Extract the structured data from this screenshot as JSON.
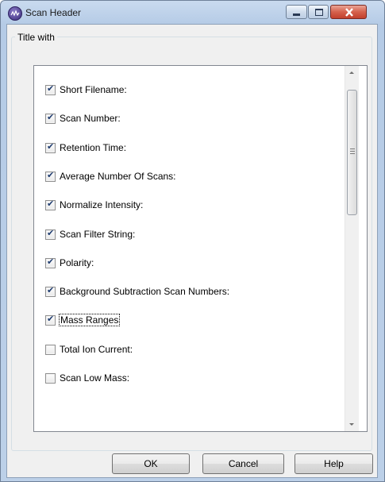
{
  "window": {
    "title": "Scan Header"
  },
  "group": {
    "legend": "Title with"
  },
  "items": [
    {
      "label": "Short Filename:",
      "checked": true
    },
    {
      "label": "Scan Number:",
      "checked": true
    },
    {
      "label": "Retention Time:",
      "checked": true
    },
    {
      "label": "Average Number Of Scans:",
      "checked": true
    },
    {
      "label": "Normalize Intensity:",
      "checked": true
    },
    {
      "label": "Scan Filter String:",
      "checked": true
    },
    {
      "label": "Polarity:",
      "checked": true
    },
    {
      "label": "Background Subtraction Scan Numbers:",
      "checked": true
    },
    {
      "label": "Mass Ranges",
      "checked": true,
      "focused": true
    },
    {
      "label": "Total Ion Current:",
      "checked": false
    },
    {
      "label": "Scan Low Mass:",
      "checked": false
    }
  ],
  "buttons": {
    "ok": "OK",
    "cancel": "Cancel",
    "help": "Help"
  },
  "icons": {
    "app": "app-logo-icon",
    "minimize": "minimize-icon",
    "maximize": "maximize-icon",
    "close": "close-icon",
    "scroll_up": "scroll-up-icon",
    "scroll_down": "scroll-down-icon"
  },
  "colors": {
    "close_button": "#c2402c",
    "titlebar": "#b5cbe6",
    "check_mark": "#1f3c6f"
  }
}
